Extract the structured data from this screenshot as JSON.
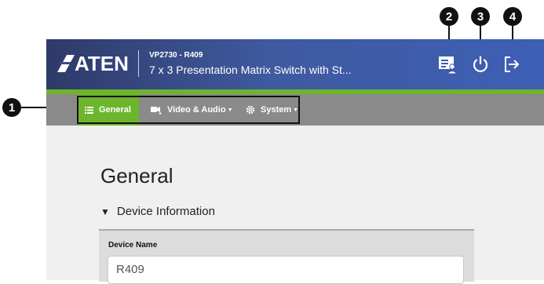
{
  "callouts": [
    "1",
    "2",
    "3",
    "4"
  ],
  "header": {
    "logo": "ATEN",
    "model": "VP2730 - R409",
    "product_name": "7 x 3 Presentation Matrix Switch with St...",
    "icons": [
      "user-console-icon",
      "power-icon",
      "logout-icon"
    ]
  },
  "nav": {
    "items": [
      {
        "label": "General",
        "icon": "list-icon",
        "active": true
      },
      {
        "label": "Video & Audio",
        "icon": "video-audio-icon",
        "dropdown": true
      },
      {
        "label": "System",
        "icon": "gear-icon",
        "dropdown": true
      }
    ]
  },
  "main": {
    "title": "General",
    "section_title": "Device Information",
    "device_name_label": "Device Name",
    "device_name_value": "R409"
  },
  "colors": {
    "header_start": "#2e3a68",
    "header_end": "#3d5fb5",
    "accent_green": "#6cb52c",
    "nav_gray": "#8a8a8a",
    "content_bg": "#f0f0f0"
  }
}
